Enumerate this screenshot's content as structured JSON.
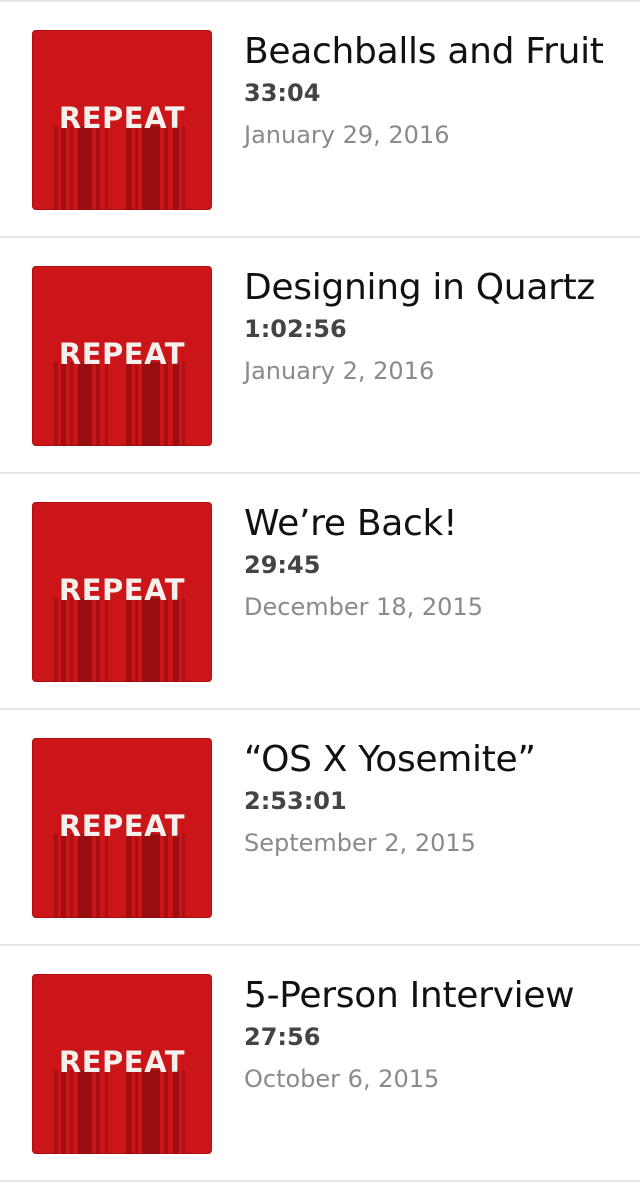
{
  "episodes": [
    {
      "artwork_text": "REPEAT",
      "title": "Beachballs and Fruit",
      "duration": "33:04",
      "date": "January 29, 2016"
    },
    {
      "artwork_text": "REPEAT",
      "title": "Designing in Quartz",
      "duration": "1:02:56",
      "date": "January 2, 2016"
    },
    {
      "artwork_text": "REPEAT",
      "title": "We’re Back!",
      "duration": "29:45",
      "date": "December 18, 2015"
    },
    {
      "artwork_text": "REPEAT",
      "title": "“OS X Yosemite”",
      "duration": "2:53:01",
      "date": "September 2, 2015"
    },
    {
      "artwork_text": "REPEAT",
      "title": "5-Person Interview",
      "duration": "27:56",
      "date": "October 6, 2015"
    }
  ],
  "colors": {
    "artwork_red": "#cc1518",
    "stripe_dark": "#8e0d10",
    "title_text": "#111111",
    "duration_text": "#444444",
    "date_text": "#8a8a8a",
    "divider": "#e6e6e6"
  }
}
